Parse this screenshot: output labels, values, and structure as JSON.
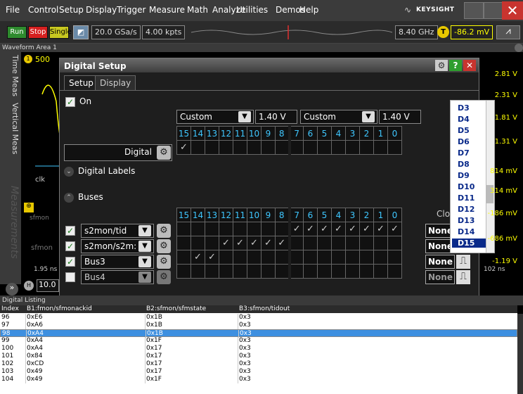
{
  "app": {
    "menu": [
      "File",
      "Control",
      "Setup",
      "Display",
      "Trigger",
      "Measure",
      "Math",
      "Analyze",
      "Utilities",
      "Demos",
      "Help"
    ],
    "brand": "KEYSIGHT"
  },
  "toolbar": {
    "run": "Run",
    "stop": "Stop",
    "single": "Single",
    "sample_rate": "20.0 GSa/s",
    "memory": "4.00 kpts",
    "bandwidth": "8.40 GHz",
    "trigger_badge": "T",
    "trigger_level": "-86.2 mV"
  },
  "waveform_area": {
    "title": "Waveform Area 1",
    "left_tabs": [
      "Time Meas",
      "Vertical Meas"
    ],
    "measurements_watermark": "Measurements",
    "channel_badge": "1",
    "channel_scale": "500",
    "y_labels": [
      "2.81 V",
      "2.31 V",
      "1.81 V",
      "1.31 V",
      "814 mV",
      "314 mV",
      "-186 mV",
      "-686 mV",
      "-1.19 V"
    ],
    "bus_labels": [
      "clk",
      "sfmon",
      "sfmon"
    ],
    "time_label_left": "1.95 ns",
    "time_label_right": "102 ns",
    "h_badge": "H",
    "h_scale": "10.0"
  },
  "dialog": {
    "title": "Digital Setup",
    "tabs": [
      "Setup",
      "Display"
    ],
    "on_label": "On",
    "thresholds": [
      {
        "mode": "Custom",
        "value": "1.40 V"
      },
      {
        "mode": "Custom",
        "value": "1.40 V"
      }
    ],
    "bit_headers": [
      "15",
      "14",
      "13",
      "12",
      "11",
      "10",
      "9",
      "8",
      "7",
      "6",
      "5",
      "4",
      "3",
      "2",
      "1",
      "0"
    ],
    "digital_label": "Digital",
    "digital_labels_section": "Digital Labels",
    "buses_section": "Buses",
    "clock_header": "Clo",
    "buses": [
      {
        "name": "s2mon/tid",
        "checked": true,
        "bits": [
          0,
          0,
          0,
          0,
          0,
          0,
          0,
          0,
          1,
          1,
          1,
          1,
          1,
          1,
          1,
          1
        ],
        "clock": "None"
      },
      {
        "name": "s2mon/s2m:",
        "checked": true,
        "bits": [
          0,
          0,
          0,
          1,
          1,
          1,
          1,
          1,
          0,
          0,
          0,
          0,
          0,
          0,
          0,
          0
        ],
        "clock": "None"
      },
      {
        "name": "Bus3",
        "checked": true,
        "bits": [
          0,
          1,
          1,
          0,
          0,
          0,
          0,
          0,
          0,
          0,
          0,
          0,
          0,
          0,
          0,
          0
        ],
        "clock": "None"
      },
      {
        "name": "Bus4",
        "checked": false,
        "bits": [
          0,
          0,
          0,
          0,
          0,
          0,
          0,
          0,
          0,
          0,
          0,
          0,
          0,
          0,
          0,
          0
        ],
        "clock": "None"
      }
    ],
    "digital_row_bits": [
      1,
      0,
      0,
      0,
      0,
      0,
      0,
      0,
      0,
      0,
      0,
      0,
      0,
      0,
      0,
      0
    ],
    "channel_list": [
      "D3",
      "D4",
      "D5",
      "D6",
      "D7",
      "D8",
      "D9",
      "D10",
      "D11",
      "D12",
      "D13",
      "D14",
      "D15"
    ]
  },
  "listing": {
    "title": "Digital Listing",
    "columns": [
      "Index",
      "B1:fmon/sfmonackid",
      "B2:sfmon/sfmstate",
      "B3:sfmon/tidout"
    ],
    "rows": [
      [
        "96",
        "0xE6",
        "0x1B",
        "0x3"
      ],
      [
        "97",
        "0xA6",
        "0x1B",
        "0x3"
      ],
      [
        "98",
        "0xA4",
        "0x1B",
        "0x3"
      ],
      [
        "99",
        "0xA4",
        "0x1F",
        "0x3"
      ],
      [
        "100",
        "0xA4",
        "0x17",
        "0x3"
      ],
      [
        "101",
        "0x84",
        "0x17",
        "0x3"
      ],
      [
        "102",
        "0xCD",
        "0x17",
        "0x3"
      ],
      [
        "103",
        "0x49",
        "0x17",
        "0x3"
      ],
      [
        "104",
        "0x49",
        "0x1F",
        "0x3"
      ]
    ],
    "selected_index": "98"
  }
}
